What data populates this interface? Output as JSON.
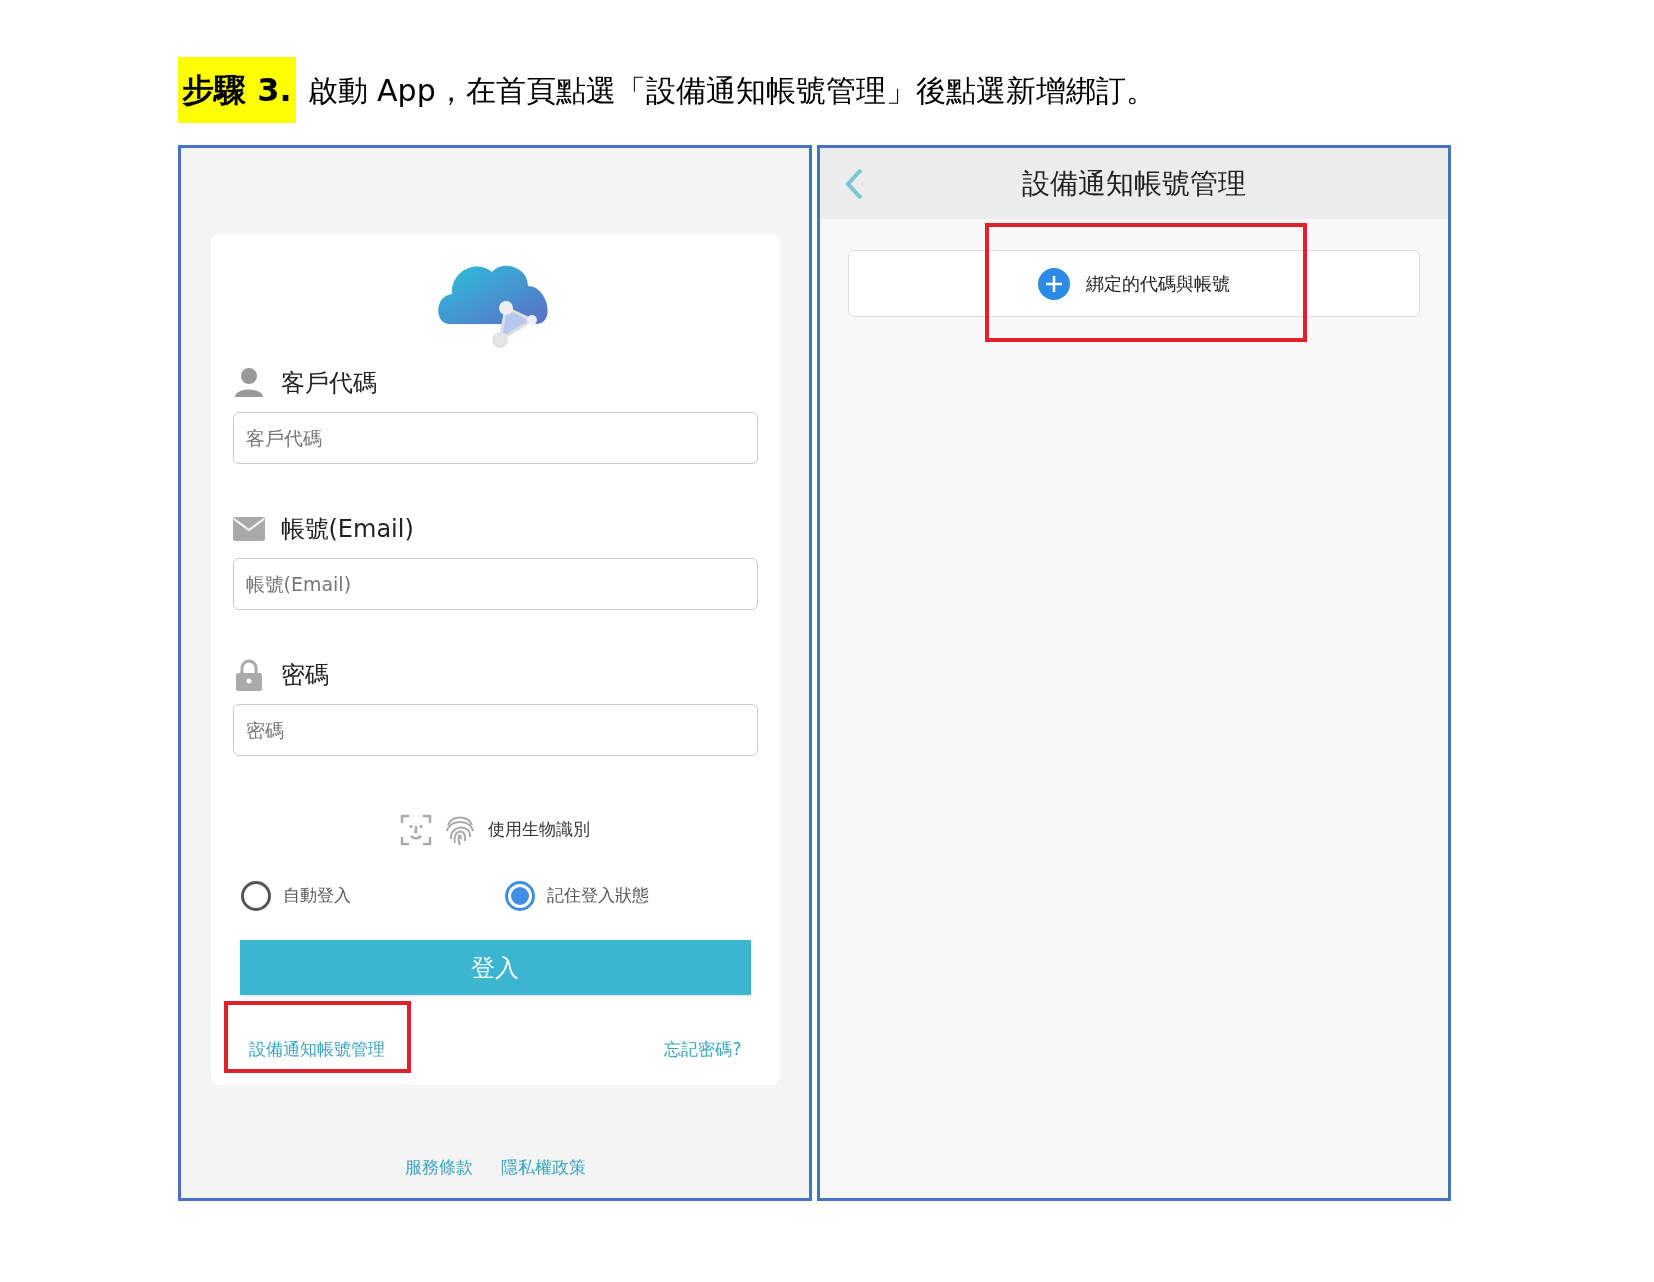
{
  "instruction": {
    "step": "步驟 3.",
    "text": "啟動 App，在首頁點選「設備通知帳號管理」後點選新增綁訂。"
  },
  "login_screen": {
    "fields": [
      {
        "kind": "user",
        "label": "客戶代碼",
        "placeholder": "客戶代碼"
      },
      {
        "kind": "mail",
        "label": "帳號(Email)",
        "placeholder": "帳號(Email)"
      },
      {
        "kind": "lock",
        "label": "密碼",
        "placeholder": "密碼"
      }
    ],
    "biometric_label": "使用生物識別",
    "options": [
      {
        "label": "自動登入",
        "selected": false
      },
      {
        "label": "記住登入狀態",
        "selected": true
      }
    ],
    "login_button": "登入",
    "manage_link": {
      "label": "設備通知帳號管理",
      "highlighted": true
    },
    "forgot_link": "忘記密碼?",
    "footer_links": [
      "服務條款",
      "隱私權政策"
    ]
  },
  "manage_screen": {
    "title": "設備通知帳號管理",
    "add_button": {
      "label": "綁定的代碼與帳號",
      "highlighted": true
    }
  }
}
